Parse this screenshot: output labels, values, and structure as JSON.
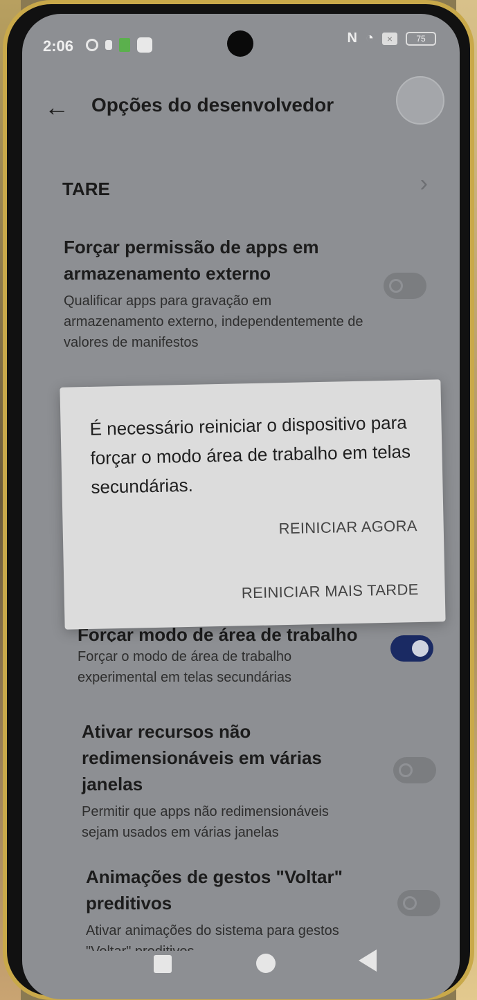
{
  "status_bar": {
    "time": "2:06",
    "battery": "75",
    "nfc": "N",
    "wifi": "◔"
  },
  "app_bar": {
    "back": "←",
    "title": "Opções do desenvolvedor"
  },
  "list": {
    "tare": {
      "title": "TARE",
      "chevron": "›"
    },
    "force_external": {
      "title": "Forçar permissão de apps em armazenamento externo",
      "subtitle": "Qualificar apps para gravação em armazenamento externo, independentemente de valores de manifestos",
      "enabled": false
    },
    "desktop_mode": {
      "title": "Forçar modo de área de trabalho",
      "subtitle": "Forçar o modo de área de trabalho experimental em telas secundárias",
      "enabled": true
    },
    "non_resizable": {
      "title": "Ativar recursos não redimensionáveis em várias janelas",
      "subtitle": "Permitir que apps não redimensionáveis sejam usados em várias janelas",
      "enabled": false
    },
    "predictive_back": {
      "title": "Animações de gestos \"Voltar\" preditivos",
      "subtitle": "Ativar animações do sistema para gestos \"Voltar\" preditivos",
      "enabled": false
    }
  },
  "dialog": {
    "message": "É necessário reiniciar o dispositivo para forçar o modo área de trabalho em telas secundárias.",
    "restart_now": "REINICIAR AGORA",
    "restart_later": "REINICIAR MAIS TARDE"
  },
  "colors": {
    "toggle_on": "#1a2a63",
    "screen_dim": "#8d8f93"
  }
}
